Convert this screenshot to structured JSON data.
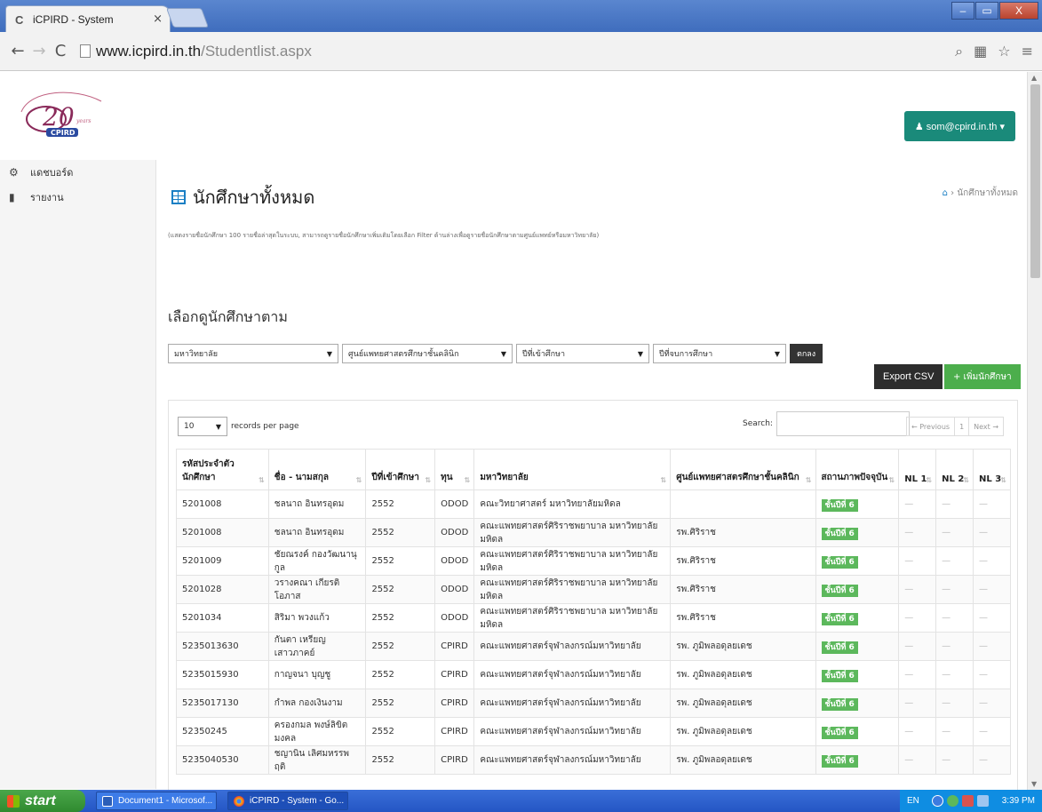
{
  "browser": {
    "tab_title": "iCPIRD - System",
    "tab_close": "×",
    "url_host": "www.icpird.in.th",
    "url_path": "/Studentlist.aspx",
    "win_min": "–",
    "win_max": "▭",
    "win_close": "X"
  },
  "header": {
    "user": "som@cpird.in.th ▾"
  },
  "sidebar": {
    "items": [
      {
        "label": "แดชบอร์ด"
      },
      {
        "label": "รายงาน"
      }
    ]
  },
  "page": {
    "title": "นักศึกษาทั้งหมด",
    "breadcrumb": "นักศึกษาทั้งหมด",
    "description": "(แสดงรายชื่อนักศึกษา 100 รายชื่อล่าสุดในระบบ, สามารถดูรายชื่อนักศึกษาเพิ่มเติมโดยเลือก Filter ด้านล่างเพื่อดูรายชื่อนักศึกษาตามศูนย์แพทย์หรือมหาวิทยาลัย)",
    "filter_title": "เลือกดูนักศึกษาตาม",
    "filters": [
      "มหาวิทยาลัย",
      "ศูนย์แพทยศาสตรศึกษาชั้นคลินิก",
      "ปีที่เข้าศึกษา",
      "ปีที่จบการศึกษา"
    ],
    "ok_label": "ตกลง",
    "export_label": "Export CSV",
    "add_label": "+ เพิ่มนักศึกษา"
  },
  "table_controls": {
    "per_page_value": "10",
    "per_page_label": "records per page",
    "search_label": "Search:",
    "prev": "← Previous",
    "page": "1",
    "next": "Next →"
  },
  "table": {
    "headers": [
      "รหัสประจำตัวนักศึกษา",
      "ชื่อ - นามสกุล",
      "ปีที่เข้าศึกษา",
      "ทุน",
      "มหาวิทยาลัย",
      "ศูนย์แพทยศาสตรศึกษาชั้นคลินิก",
      "สถานภาพปัจจุบัน",
      "NL 1",
      "NL 2",
      "NL 3"
    ],
    "rows": [
      [
        "5201008",
        "ชลนาถ อินทรอุดม",
        "2552",
        "ODOD",
        "คณะวิทยาศาสตร์ มหาวิทยาลัยมหิดล",
        "",
        "ชั้นปีที่ 6",
        "—",
        "—",
        "—"
      ],
      [
        "5201008",
        "ชลนาถ อินทรอุดม",
        "2552",
        "ODOD",
        "คณะแพทยศาสตร์ศิริราชพยาบาล มหาวิทยาลัยมหิดล",
        "รพ.ศิริราช",
        "ชั้นปีที่ 6",
        "—",
        "—",
        "—"
      ],
      [
        "5201009",
        "ชัยณรงค์ กองวัฒนานุกูล",
        "2552",
        "ODOD",
        "คณะแพทยศาสตร์ศิริราชพยาบาล มหาวิทยาลัยมหิดล",
        "รพ.ศิริราช",
        "ชั้นปีที่ 6",
        "—",
        "—",
        "—"
      ],
      [
        "5201028",
        "วรางคณา เกียรติโอภาส",
        "2552",
        "ODOD",
        "คณะแพทยศาสตร์ศิริราชพยาบาล มหาวิทยาลัยมหิดล",
        "รพ.ศิริราช",
        "ชั้นปีที่ 6",
        "—",
        "—",
        "—"
      ],
      [
        "5201034",
        "สิริมา พวงแก้ว",
        "2552",
        "ODOD",
        "คณะแพทยศาสตร์ศิริราชพยาบาล มหาวิทยาลัยมหิดล",
        "รพ.ศิริราช",
        "ชั้นปีที่ 6",
        "—",
        "—",
        "—"
      ],
      [
        "5235013630",
        "กันตา เหรียญเสาวภาคย์",
        "2552",
        "CPIRD",
        "คณะแพทยศาสตร์จุฬาลงกรณ์มหาวิทยาลัย",
        "รพ. ภูมิพลอดุลยเดช",
        "ชั้นปีที่ 6",
        "—",
        "—",
        "—"
      ],
      [
        "5235015930",
        "กาญจนา บุญชู",
        "2552",
        "CPIRD",
        "คณะแพทยศาสตร์จุฬาลงกรณ์มหาวิทยาลัย",
        "รพ. ภูมิพลอดุลยเดช",
        "ชั้นปีที่ 6",
        "—",
        "—",
        "—"
      ],
      [
        "5235017130",
        "กำพล กองเงินงาม",
        "2552",
        "CPIRD",
        "คณะแพทยศาสตร์จุฬาลงกรณ์มหาวิทยาลัย",
        "รพ. ภูมิพลอดุลยเดช",
        "ชั้นปีที่ 6",
        "—",
        "—",
        "—"
      ],
      [
        "52350245",
        "ครองกมล พงษ์ลิขิตมงคล",
        "2552",
        "CPIRD",
        "คณะแพทยศาสตร์จุฬาลงกรณ์มหาวิทยาลัย",
        "รพ. ภูมิพลอดุลยเดช",
        "ชั้นปีที่ 6",
        "—",
        "—",
        "—"
      ],
      [
        "5235040530",
        "ชญานิน เลิศมหรรพฤติ",
        "2552",
        "CPIRD",
        "คณะแพทยศาสตร์จุฬาลงกรณ์มหาวิทยาลัย",
        "รพ. ภูมิพลอดุลยเดช",
        "ชั้นปีที่ 6",
        "—",
        "—",
        "—"
      ]
    ]
  },
  "taskbar": {
    "start": "start",
    "tasks": [
      "Document1 - Microsof...",
      "iCPIRD - System - Go..."
    ],
    "lang": "EN",
    "time": "3:39 PM"
  }
}
